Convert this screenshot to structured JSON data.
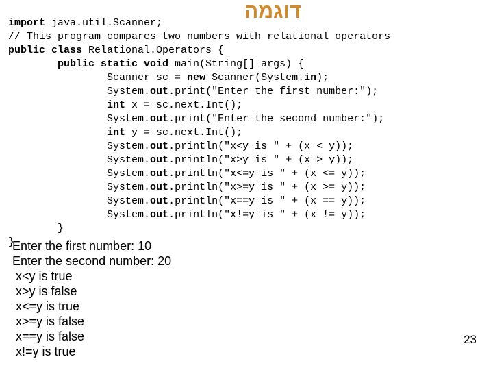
{
  "slide": {
    "title": "דוגמה",
    "pageNumber": "23"
  },
  "code": {
    "l1a": "import",
    "l1b": " java.util.Scanner;",
    "l2": "// This program compares two numbers with relational operators",
    "l3a": "public class",
    "l3b": " Relational.Operators {",
    "l4a": "        public static void",
    "l4b": " main(String[] args) {",
    "l5a": "                Scanner sc = ",
    "l5b": "new",
    "l5c": " Scanner(System.",
    "l5d": "in",
    "l5e": ");",
    "l6a": "                System.",
    "l6b": "out",
    "l6c": ".print(\"Enter the first number:\");",
    "l7a": "                ",
    "l7b": "int",
    "l7c": " x = sc.next.Int();",
    "l8a": "                System.",
    "l8b": "out",
    "l8c": ".print(\"Enter the second number:\");",
    "l9a": "                ",
    "l9b": "int",
    "l9c": " y = sc.next.Int();",
    "l10a": "                System.",
    "l10b": "out",
    "l10c": ".println(\"x<y is \" + (x < y));",
    "l11a": "                System.",
    "l11b": "out",
    "l11c": ".println(\"x>y is \" + (x > y));",
    "l12a": "                System.",
    "l12b": "out",
    "l12c": ".println(\"x<=y is \" + (x <= y));",
    "l13a": "                System.",
    "l13b": "out",
    "l13c": ".println(\"x>=y is \" + (x >= y));",
    "l14a": "                System.",
    "l14b": "out",
    "l14c": ".println(\"x==y is \" + (x == y));",
    "l15a": "                System.",
    "l15b": "out",
    "l15c": ".println(\"x!=y is \" + (x != y));",
    "l16": "        }",
    "l17": "}"
  },
  "output": {
    "l1": "Enter the first number: 10",
    "l2": "Enter the second number: 20",
    "l3": " x<y is true",
    "l4": " x>y is false",
    "l5": " x<=y is true",
    "l6": " x>=y is false",
    "l7": " x==y is false",
    "l8": " x!=y is true"
  }
}
